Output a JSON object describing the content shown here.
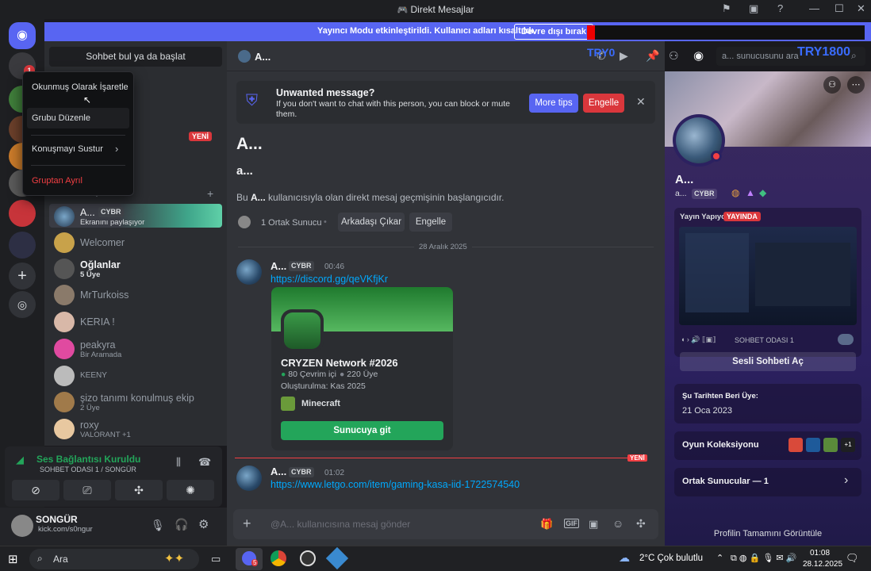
{
  "window": {
    "title": "Direkt Mesajlar",
    "controls": [
      "—",
      "☐",
      "✕"
    ]
  },
  "banner": {
    "text": "Yayıncı Modu etkinleştirildi. Kullanıcı adları kısaltıldı.",
    "disable_button": "Devre dışı bırak"
  },
  "overlay_texts": {
    "try1": "TRY0",
    "try2": "TRY1800"
  },
  "rail": {
    "badge": "1"
  },
  "sidebar": {
    "search_label": "Sohbet bul ya da başlat",
    "new_badge": "YENİ",
    "dm_header": "Direkt Mesajlar",
    "items": [
      {
        "name": "A...",
        "tag": "CYBR",
        "sub": "Ekranını paylaşıyor",
        "active": true
      },
      {
        "name": "Welcomer",
        "sub": ""
      },
      {
        "name": "Oğlanlar",
        "sub": "5 Üye"
      },
      {
        "name": "MrTurkoiss",
        "sub": ""
      },
      {
        "name": "KERIA !",
        "sub": ""
      },
      {
        "name": "peakyra",
        "sub": "Bir Aramada"
      },
      {
        "name": "KEENY",
        "sub": ""
      },
      {
        "name": "şizo tanımı konulmuş ekip",
        "sub": "2 Üye"
      },
      {
        "name": "roxy",
        "sub": "VALORANT +1"
      }
    ]
  },
  "context_menu": {
    "items": [
      "Okunmuş Olarak İşaretle",
      "Grubu Düzenle",
      "Konuşmayı Sustur",
      "Gruptan Ayrıl"
    ]
  },
  "voice": {
    "status": "Ses Bağlantısı Kuruldu",
    "channel": "SOHBET ODASI 1 / SONGÜR"
  },
  "user": {
    "name": "SONGÜR",
    "status": "kick.com/s0ngur"
  },
  "chat": {
    "header_name": "A...",
    "search_placeholder": "a... sunucusunu ara",
    "warning_title": "Unwanted message?",
    "warning_body": "If you don't want to chat with this person, you can block or mute them.",
    "more_tips": "More tips",
    "block": "Engelle",
    "intro_name": "A...",
    "intro_username": "a...",
    "intro_prefix": "Bu ",
    "intro_name_bold": "A...",
    "intro_suffix": " kullanıcısıyla olan direkt mesaj geçmişinin başlangıcıdır.",
    "mutual_servers": "1 Ortak Sunucu",
    "remove_friend": "Arkadaşı Çıkar",
    "block2": "Engelle",
    "date_divider": "28 Aralık 2025",
    "new_label": "YENİ",
    "messages": [
      {
        "author": "A...",
        "tag": "CYBR",
        "time": "00:46",
        "link": "https://discord.gg/qeVKfjKr"
      },
      {
        "author": "A...",
        "tag": "CYBR",
        "time": "01:02",
        "link": "https://www.letgo.com/item/gaming-kasa-iid-1722574540"
      }
    ],
    "invite": {
      "server_name": "CRYZEN Network #2026",
      "online": "80 Çevrim içi",
      "members": "220 Üye",
      "created": "Oluşturulma: Kas 2025",
      "game": "Minecraft",
      "join_button": "Sunucuya git"
    },
    "composer_placeholder": "@A... kullanıcısına mesaj gönder"
  },
  "profile": {
    "name": "A...",
    "username": "a...",
    "tag": "CYBR",
    "streaming_label": "Yayın Yapıyor",
    "live_badge": "YAYINDA",
    "stream_channel": "SOHBET ODASI 1",
    "join_voice": "Sesli Sohbeti Aç",
    "member_since_label": "Şu Tarihten Beri Üye:",
    "member_since": "21 Oca 2023",
    "game_collection": "Oyun Koleksiyonu",
    "game_more": "+1",
    "mutual_servers": "Ortak Sunucular — 1",
    "view_full": "Profilin Tamamını Görüntüle"
  },
  "taskbar": {
    "search": "Ara",
    "notif_count": "5",
    "weather": "2°C  Çok bulutlu",
    "time": "01:08",
    "date": "28.12.2025"
  },
  "colors": {
    "blurple": "#5865f2",
    "danger": "#da373c",
    "green": "#23a55a",
    "link": "#00a8fc"
  }
}
